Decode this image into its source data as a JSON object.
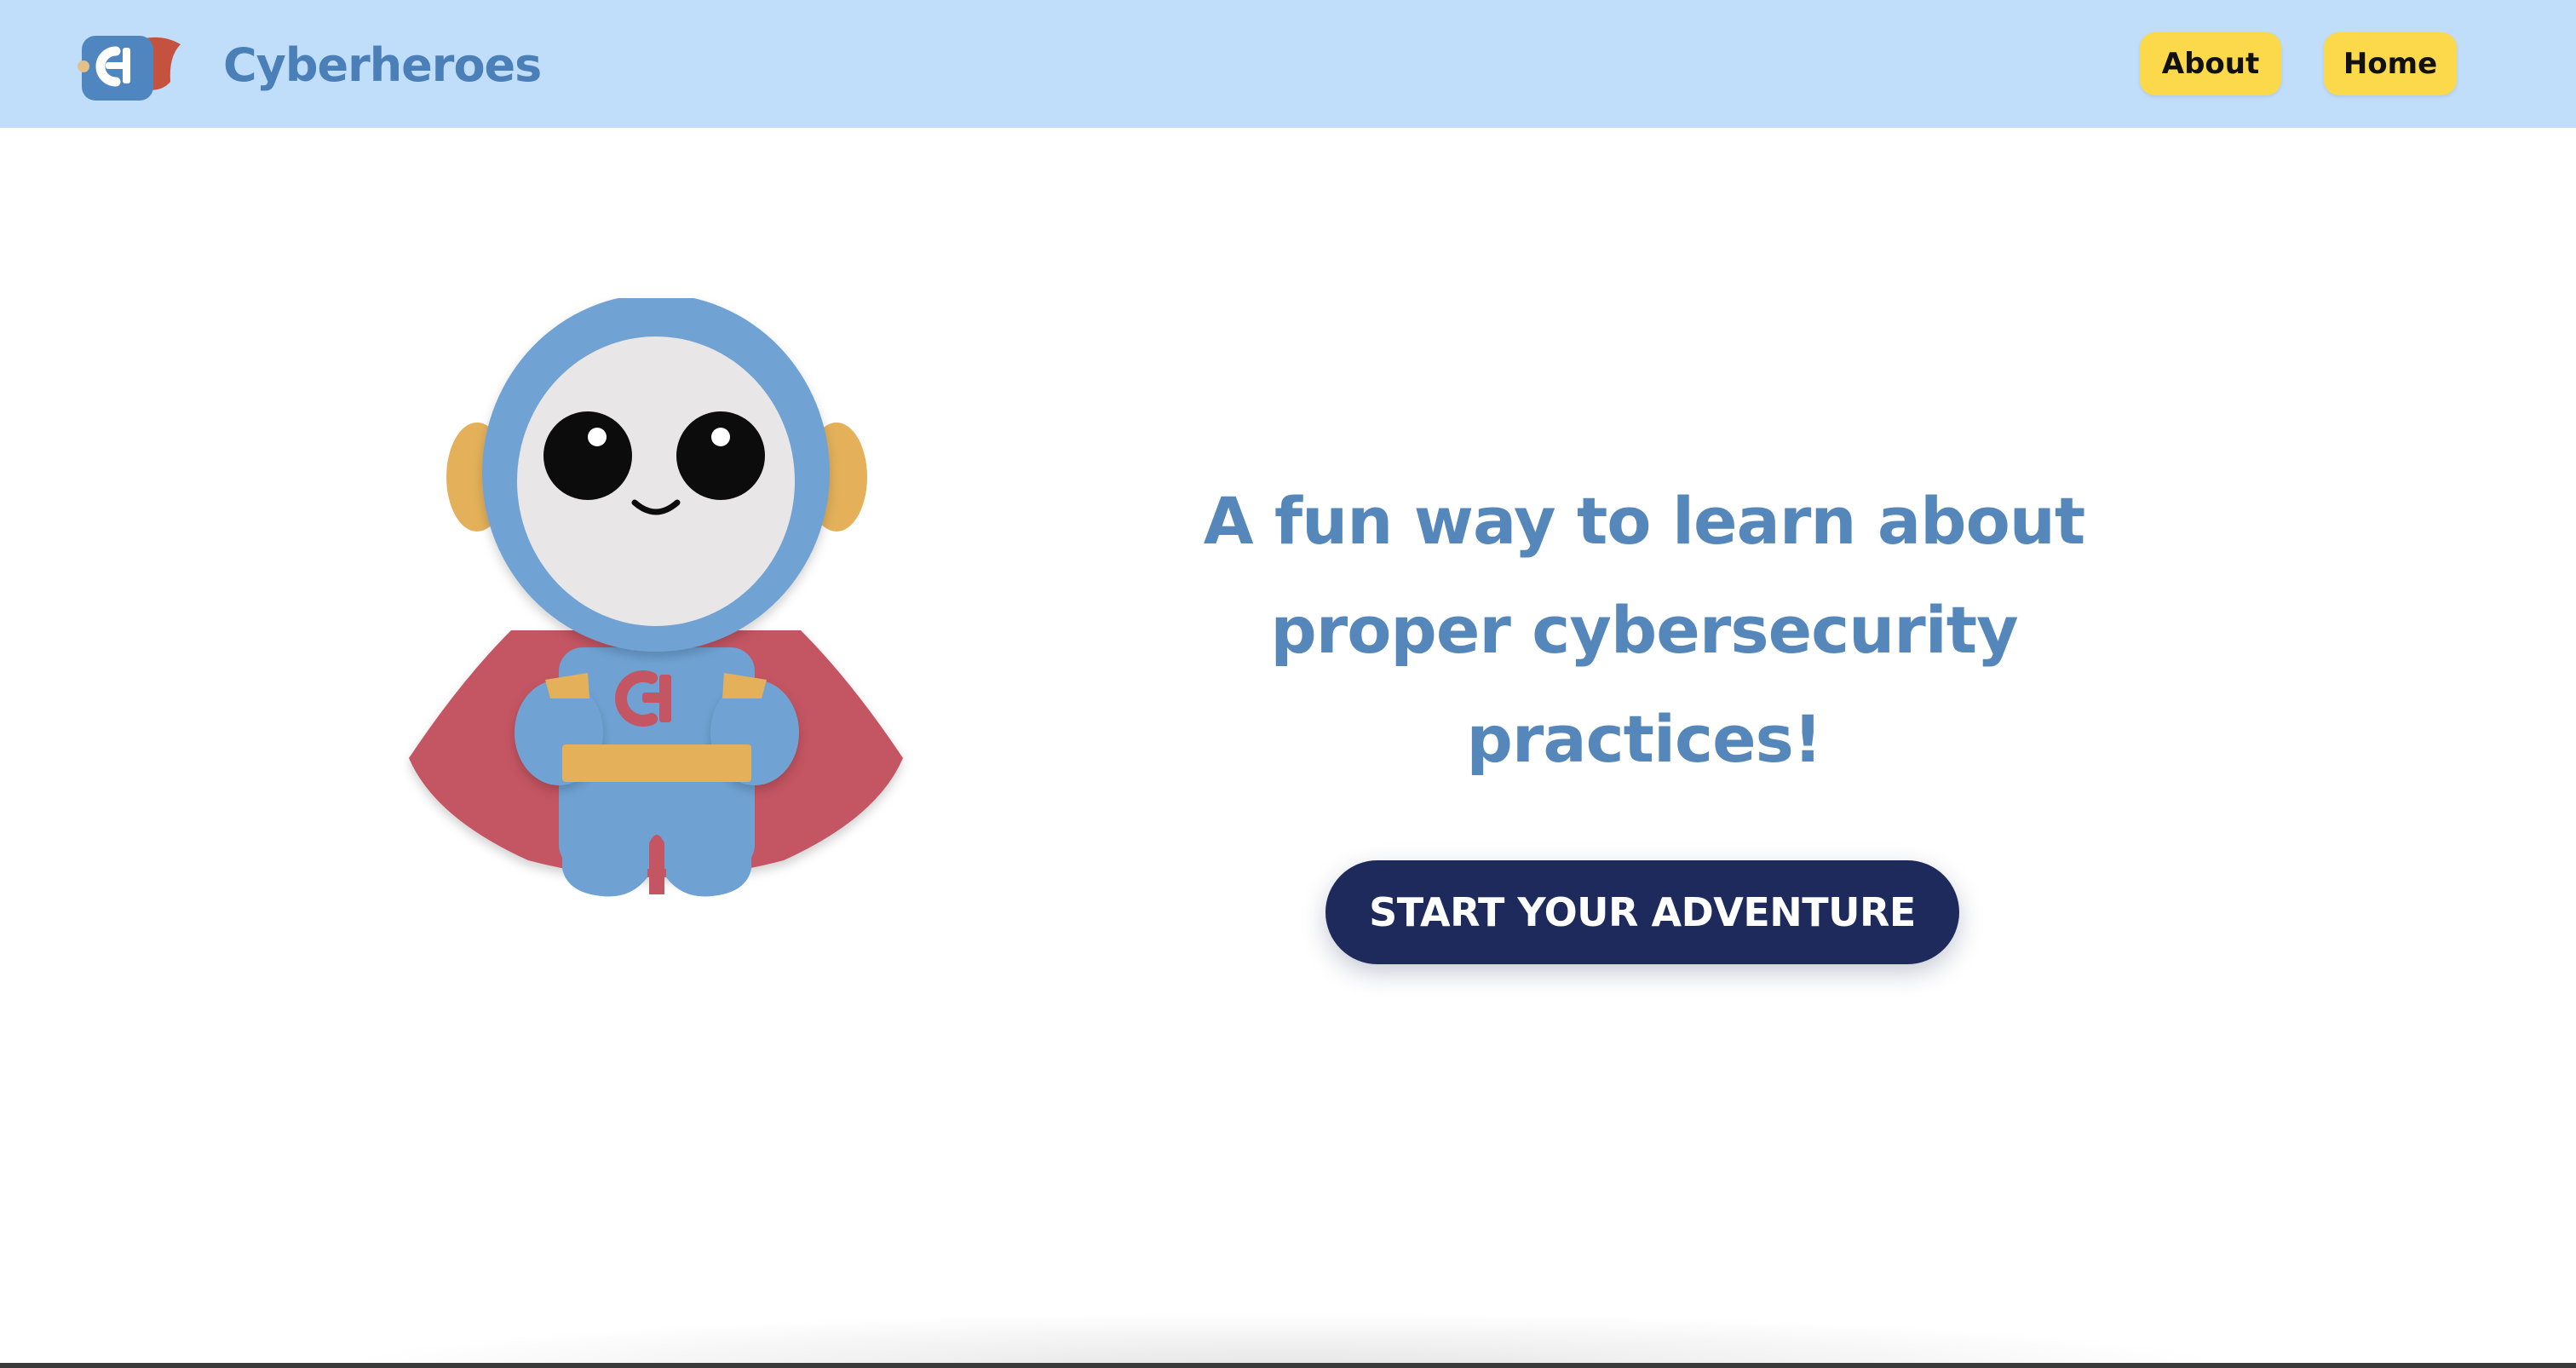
{
  "header": {
    "brand_name": "Cyberheroes",
    "logo_icon": "cyberheroes-logo-icon",
    "nav": [
      {
        "label": "About"
      },
      {
        "label": "Home"
      }
    ]
  },
  "hero": {
    "mascot_icon": "cyberhero-mascot-icon",
    "tagline": "A fun way to learn about proper cybersecurity practices!",
    "cta_label": "START YOUR ADVENTURE"
  },
  "colors": {
    "header_bg": "#c0ddf9",
    "brand_text": "#4a7fb8",
    "nav_button": "#fbd94b",
    "tagline_text": "#5687ba",
    "cta_bg": "#1f2a5c",
    "mascot_blue": "#6fa2d3",
    "mascot_cape": "#c45562",
    "mascot_gold": "#e4b15a"
  }
}
